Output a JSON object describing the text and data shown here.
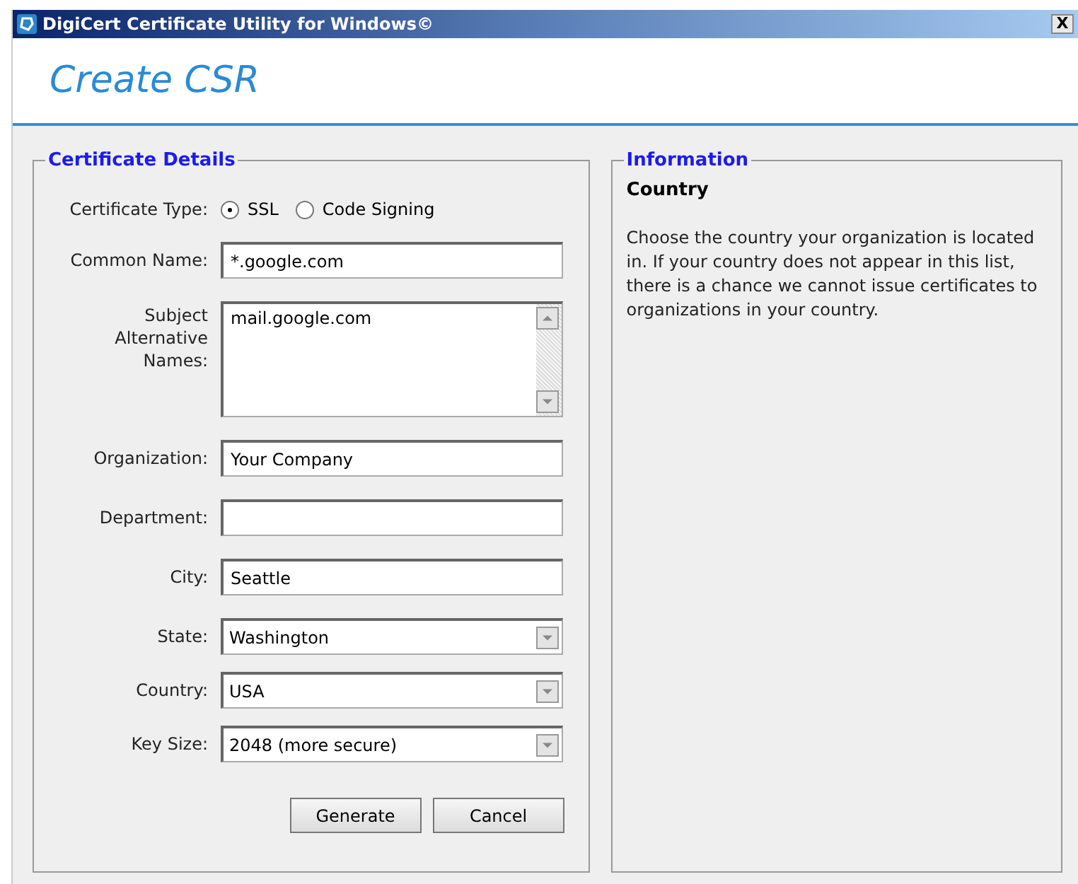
{
  "window": {
    "title": "DigiCert Certificate Utility for Windows©",
    "close": "X"
  },
  "header": {
    "title": "Create CSR"
  },
  "details": {
    "legend": "Certificate Details",
    "certificate_type": {
      "label": "Certificate Type:",
      "options": [
        {
          "label": "SSL",
          "selected": true
        },
        {
          "label": "Code Signing",
          "selected": false
        }
      ]
    },
    "fields": [
      {
        "kind": "text",
        "label": "Common Name:",
        "value": "*.google.com"
      },
      {
        "kind": "textarea",
        "label": "Subject Alternative Names:",
        "value": "mail.google.com"
      },
      {
        "kind": "text",
        "label": "Organization:",
        "value": "Your Company"
      },
      {
        "kind": "text",
        "label": "Department:"
      },
      {
        "kind": "text",
        "label": "City:",
        "value": "Seattle"
      },
      {
        "kind": "select",
        "label": "State:",
        "value": "Washington"
      },
      {
        "kind": "select",
        "label": "Country:",
        "value": "USA"
      },
      {
        "kind": "select",
        "label": "Key Size:",
        "value": "2048 (more secure)"
      }
    ],
    "buttons": [
      "Generate",
      "Cancel"
    ]
  },
  "information": {
    "legend": "Information",
    "heading": "Country",
    "text": "Choose the country your organization is located in. If your country does not appear in this list, there is a chance we cannot issue certificates to organizations in your country."
  }
}
